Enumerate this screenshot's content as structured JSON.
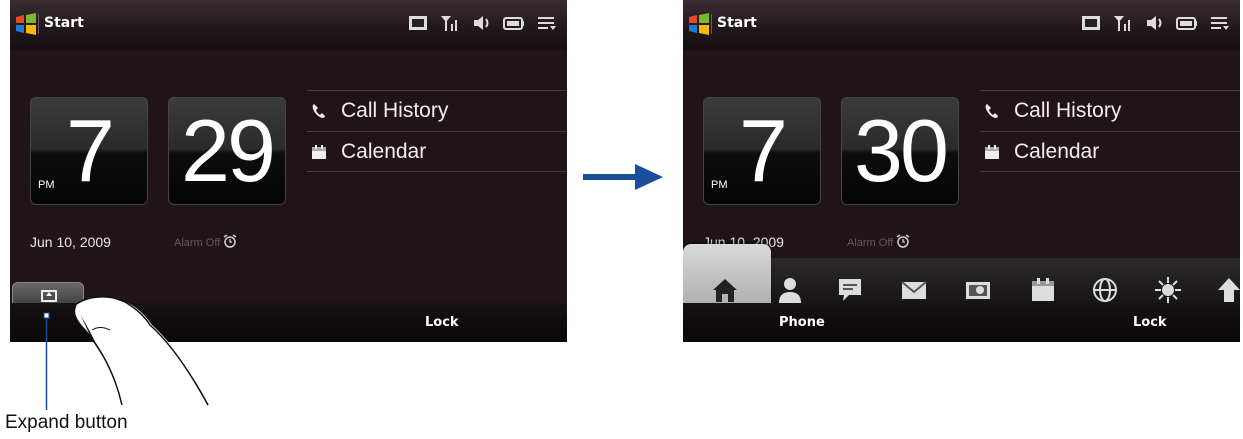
{
  "left_screen": {
    "title": "Start",
    "clock": {
      "hour": "7",
      "minute": "29",
      "ampm": "PM"
    },
    "links": [
      {
        "label": "Call History",
        "icon": "phone-icon"
      },
      {
        "label": "Calendar",
        "icon": "calendar-icon"
      }
    ],
    "date": "Jun 10, 2009",
    "alarm": "Alarm Off",
    "softkeys": {
      "right": "Lock"
    }
  },
  "right_screen": {
    "title": "Start",
    "clock": {
      "hour": "7",
      "minute": "30",
      "ampm": "PM"
    },
    "links": [
      {
        "label": "Call History",
        "icon": "phone-icon"
      },
      {
        "label": "Calendar",
        "icon": "calendar-icon"
      }
    ],
    "date": "Jun 10, 2009",
    "alarm": "Alarm Off",
    "tabs": [
      "home-icon",
      "people-icon",
      "messages-icon",
      "mail-icon",
      "photos-icon",
      "calendar-icon",
      "internet-icon",
      "weather-icon",
      "settings-icon"
    ],
    "softkeys": {
      "left": "Phone",
      "right": "Lock"
    }
  },
  "callout": {
    "label": "Expand button"
  },
  "colors": {
    "screen_bg": "#211419",
    "arrow": "#1a4d9a",
    "callout_line": "#1a4d9a"
  }
}
